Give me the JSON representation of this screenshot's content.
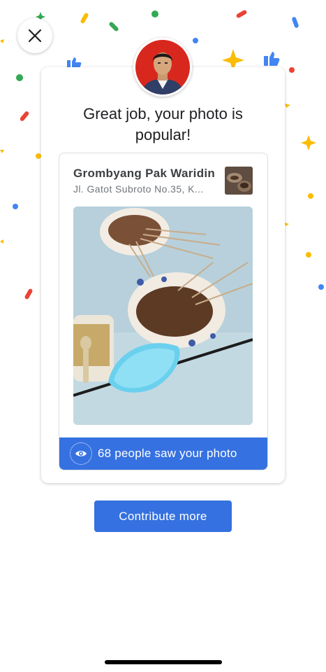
{
  "dialog": {
    "headline_line1": "Great job, your photo is",
    "headline_line2": "popular!",
    "close_label": "Close"
  },
  "place": {
    "name": "Grombyang Pak Waridin",
    "address": "Jl. Gatot Subroto No.35, K..."
  },
  "stats": {
    "views_text": "68 people saw your photo",
    "icon": "eye-icon"
  },
  "actions": {
    "contribute_label": "Contribute more"
  },
  "colors": {
    "accent": "#3571e0",
    "confetti_blue": "#4285f4",
    "confetti_red": "#ea4335",
    "confetti_yellow": "#fbbc04",
    "confetti_green": "#34a853"
  }
}
